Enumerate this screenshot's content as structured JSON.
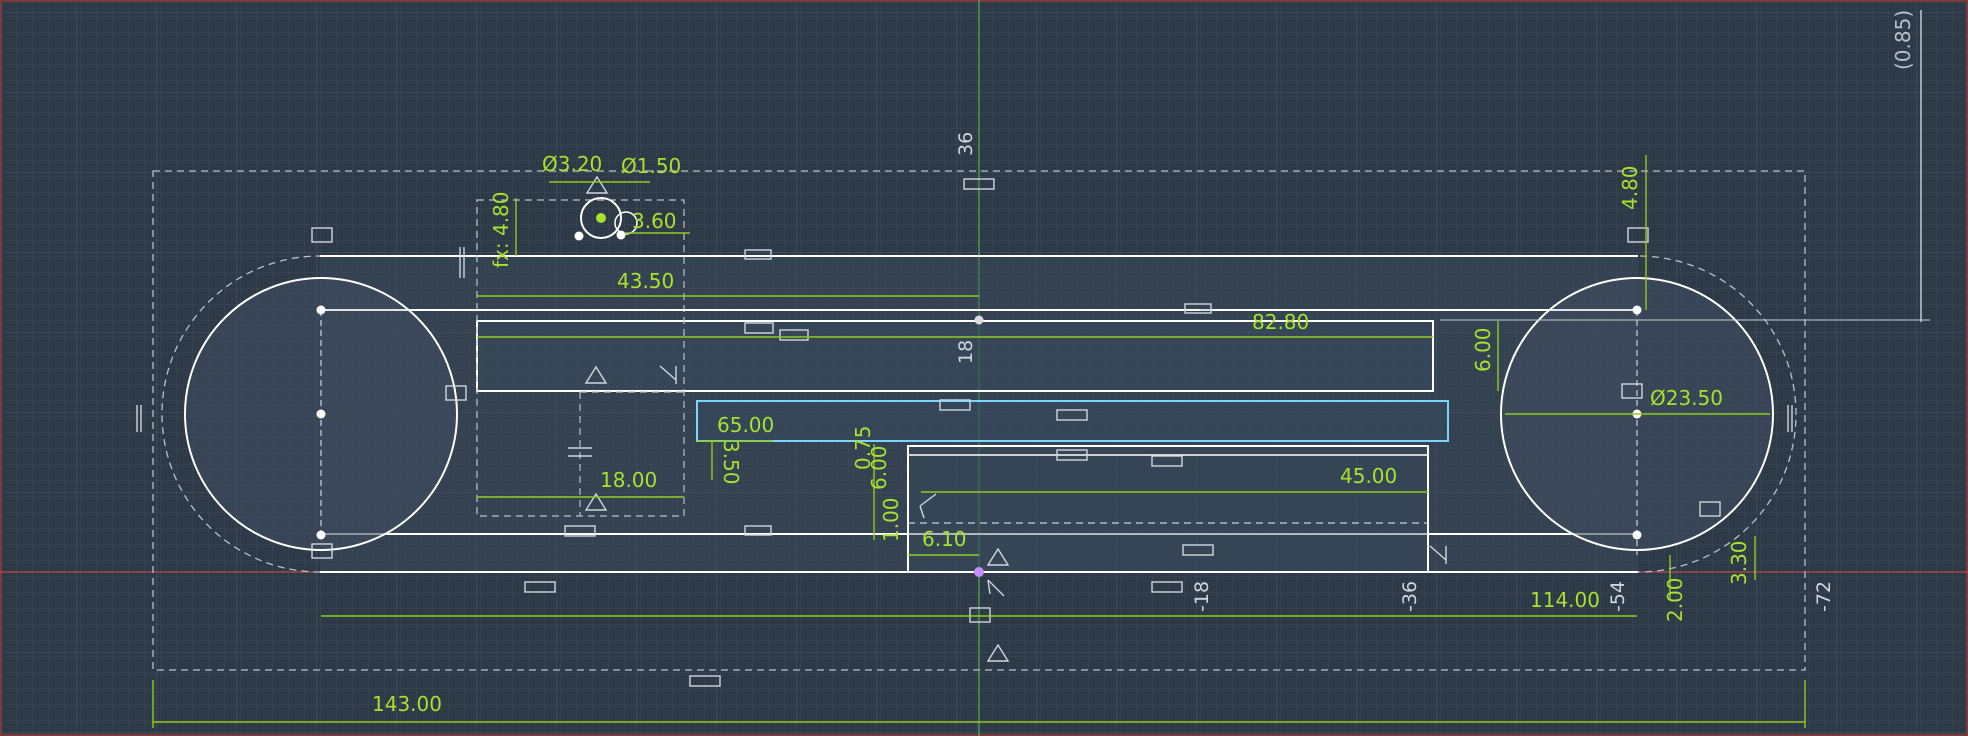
{
  "dimensions": {
    "phi_320": "Ø3.20",
    "phi_150": "Ø1.50",
    "d_480_fix": "fx: 4.80",
    "d_360": "3.60",
    "d_4350": "43.50",
    "d_8280": "82.80",
    "d_600": "6.00",
    "d_6500": "65.00",
    "d_350": "3.50",
    "d_1800": "18.00",
    "d_075": "0.75",
    "d_600b": "6.00",
    "d_100": "1.00",
    "d_610": "6.10",
    "d_4500": "45.00",
    "d_11400": "114.00",
    "d_14300": "143.00",
    "d_480": "4.80",
    "phi_2350": "Ø23.50",
    "d_330": "3.30",
    "d_200": "2.00",
    "d_085": "(0.85)"
  },
  "axis_labels": {
    "x_36": "36",
    "x_18": "18",
    "x_m18": "-18",
    "x_m36": "-36",
    "x_m54": "-54",
    "x_m72": "-72"
  },
  "colors": {
    "background": "#2f3a48",
    "sketch_line": "#ffffff",
    "dimension": "#a6e22e",
    "construction": "#b8c0c8",
    "selection": "#7fd3ff",
    "x_axis": "#c44a4a",
    "y_axis": "#4bb84b"
  }
}
